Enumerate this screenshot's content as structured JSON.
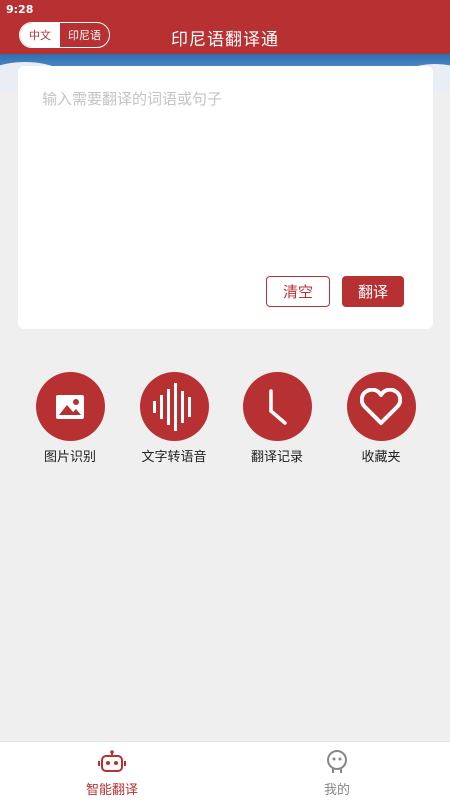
{
  "status_bar": {
    "time": "9:28"
  },
  "header": {
    "title": "印尼语翻译通",
    "lang_options": [
      "中文",
      "印尼语"
    ],
    "active_lang": "中文"
  },
  "colors": {
    "brand": "#b73133",
    "background": "#efefef",
    "tab_inactive": "#888888"
  },
  "input": {
    "placeholder": "输入需要翻译的词语或句子",
    "value": "",
    "clear_label": "清空",
    "translate_label": "翻译"
  },
  "features": [
    {
      "label": "图片识别",
      "icon": "image-icon"
    },
    {
      "label": "文字转语音",
      "icon": "sound-wave-icon"
    },
    {
      "label": "翻译记录",
      "icon": "clock-icon"
    },
    {
      "label": "收藏夹",
      "icon": "heart-icon"
    }
  ],
  "tabs": [
    {
      "label": "智能翻译",
      "icon": "robot-icon",
      "active": true
    },
    {
      "label": "我的",
      "icon": "face-icon",
      "active": false
    }
  ]
}
